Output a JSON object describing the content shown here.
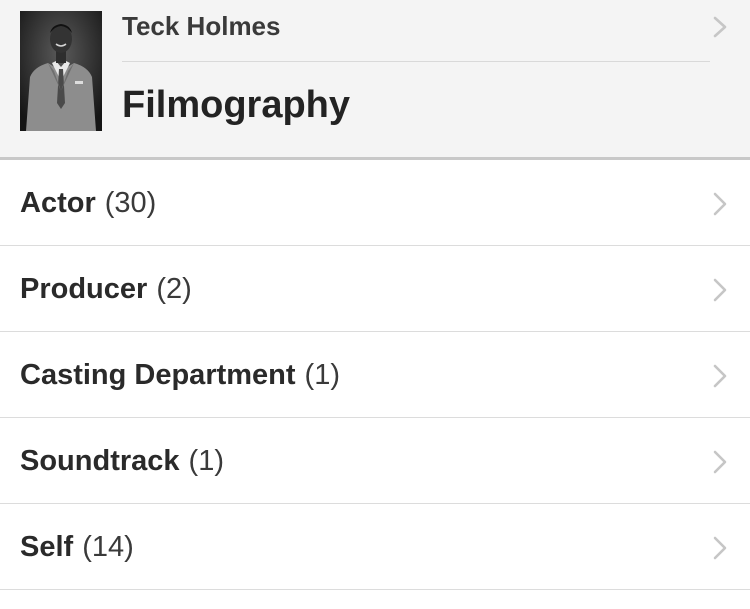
{
  "header": {
    "name": "Teck Holmes",
    "title": "Filmography",
    "photo_icon": "person-portrait"
  },
  "categories": [
    {
      "label": "Actor",
      "count": "(30)"
    },
    {
      "label": "Producer",
      "count": "(2)"
    },
    {
      "label": "Casting Department",
      "count": "(1)"
    },
    {
      "label": "Soundtrack",
      "count": "(1)"
    },
    {
      "label": "Self",
      "count": "(14)"
    }
  ],
  "colors": {
    "header_bg": "#f4f4f4",
    "divider": "#dcdcdc",
    "chevron": "#c6c6c6",
    "text_primary": "#2a2a2a"
  }
}
